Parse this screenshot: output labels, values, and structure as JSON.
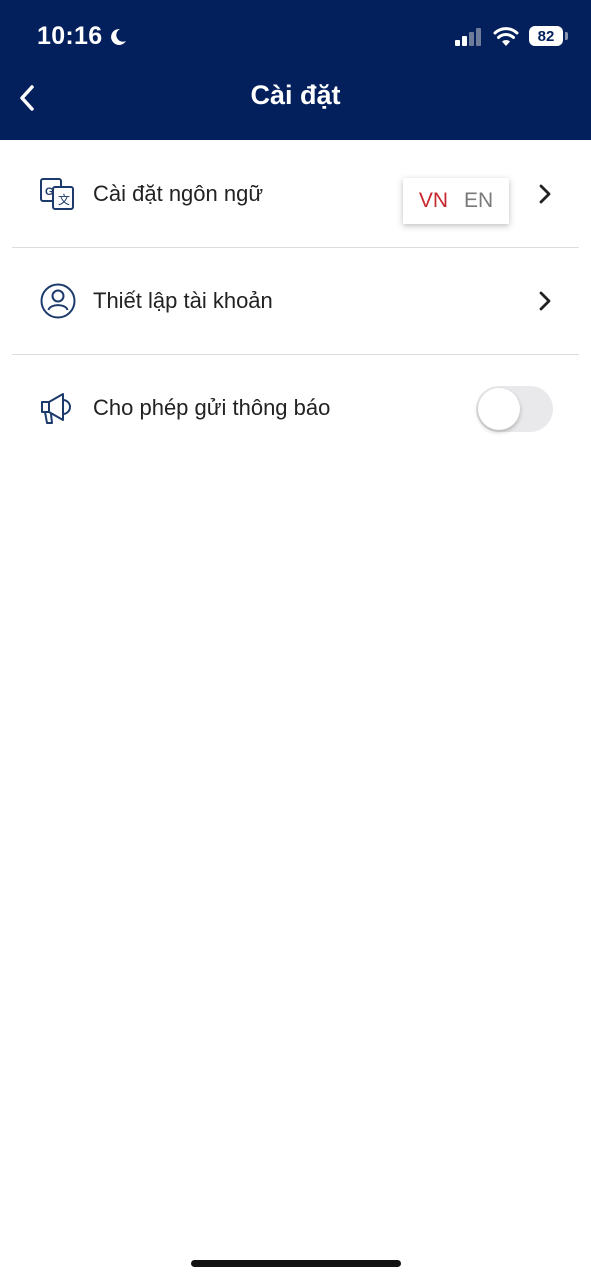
{
  "status_bar": {
    "time": "10:16",
    "battery": "82",
    "icons": [
      "moon-icon",
      "cellular-signal-icon",
      "wifi-icon",
      "battery-icon"
    ]
  },
  "header": {
    "title": "Cài đặt",
    "back_icon": "chevron-left-icon"
  },
  "settings": {
    "language": {
      "label": "Cài đặt ngôn ngữ",
      "icon": "translate-icon",
      "options": [
        "VN",
        "EN"
      ],
      "selected": "VN"
    },
    "account": {
      "label": "Thiết lập tài khoản",
      "icon": "user-circle-icon"
    },
    "notifications": {
      "label": "Cho phép gửi thông báo",
      "icon": "megaphone-icon",
      "enabled": false
    }
  },
  "colors": {
    "header_bg": "#03205c",
    "selected_lang": "#c8282d",
    "unselected_lang": "#7a7a7a",
    "icon": "#1c3a6b"
  }
}
